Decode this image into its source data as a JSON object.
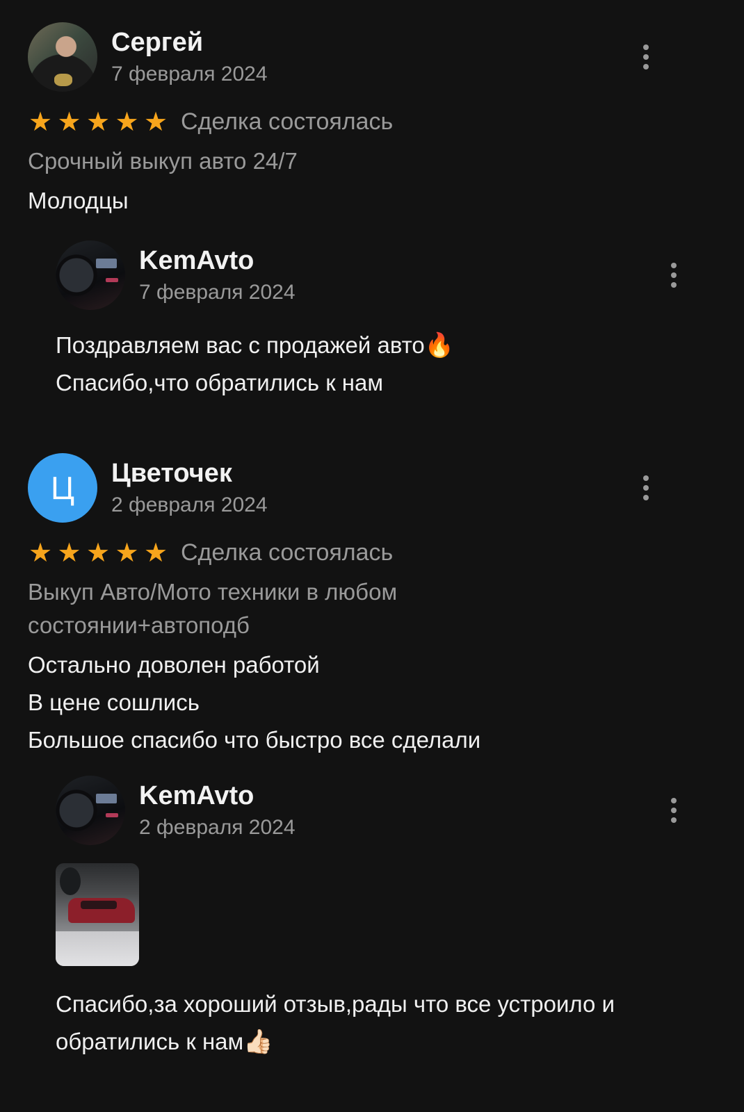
{
  "reviews": [
    {
      "author": "Сергей",
      "date": "7 февраля 2024",
      "rating": 5,
      "deal_status": "Сделка состоялась",
      "service": "Срочный выкуп авто 24/7",
      "text": "Молодцы",
      "reply": {
        "author": "KemAvto",
        "date": "7 февраля 2024",
        "line1": "Поздравляем вас с продажей авто",
        "line1_emoji": "🔥",
        "line2": "Спасибо,что обратились к нам"
      }
    },
    {
      "author": "Цветочек",
      "avatar_letter": "Ц",
      "date": "2 февраля 2024",
      "rating": 5,
      "deal_status": "Сделка состоялась",
      "service_line1": "Выкуп Авто/Мото техники в любом",
      "service_line2": "состоянии+автоподб",
      "text_lines": [
        "Остально доволен работой",
        "В цене сошлись",
        "Большое спасибо что быстро все сделали"
      ],
      "reply": {
        "author": "KemAvto",
        "date": "2 февраля 2024",
        "line1": "Спасибо,за хороший отзыв,рады что все устроило и",
        "line2": "обратились к нам",
        "line2_emoji": "👍🏻"
      }
    }
  ],
  "colors": {
    "background": "#121212",
    "star": "#f7a51c",
    "muted_text": "#9a9a9a",
    "letter_avatar": "#3aa0f0"
  },
  "icons": {
    "star": "★",
    "more": "more-vertical-icon"
  }
}
